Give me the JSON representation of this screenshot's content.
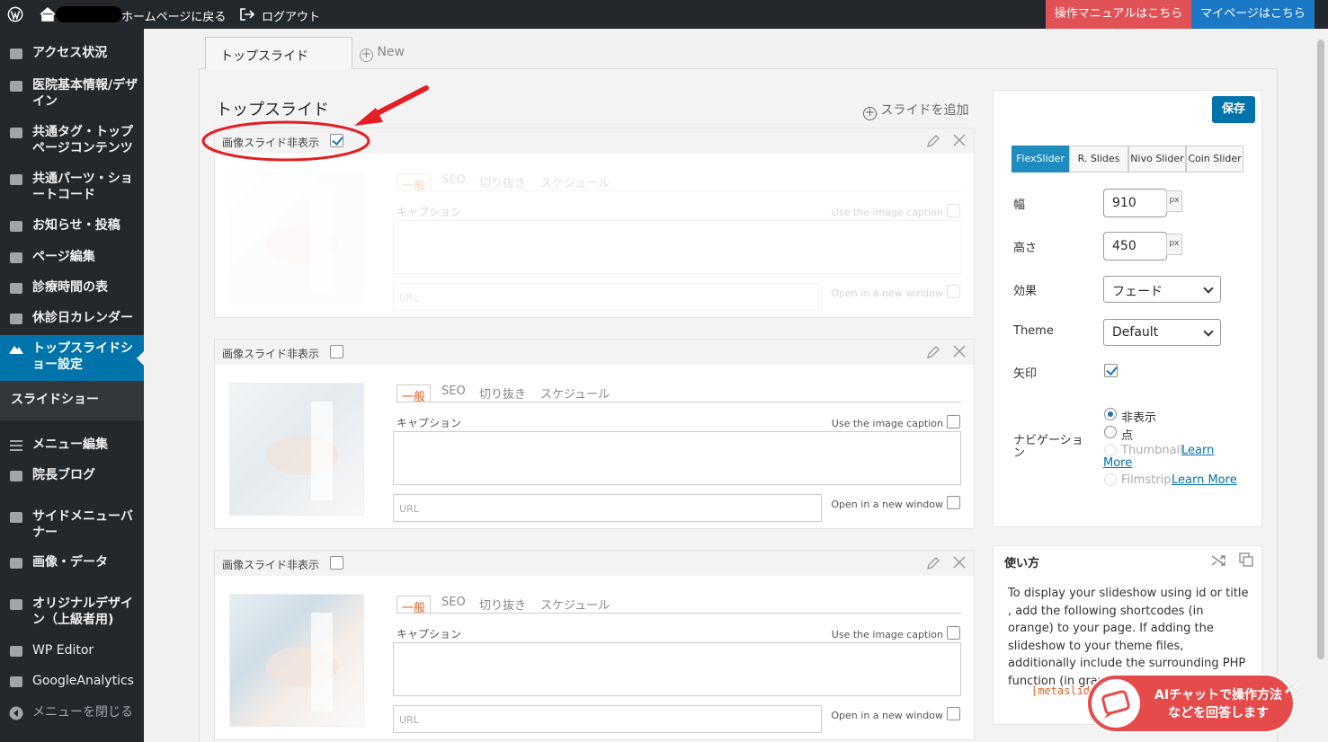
{
  "topbar": {
    "home_label": "ホームページに戻る",
    "logout_label": "ログアウト",
    "manual_button": "操作マニュアルはこちら",
    "mypage_button": "マイページはこちら"
  },
  "sidebar": {
    "items": [
      {
        "label": "アクセス状況",
        "icon": "chart-icon"
      },
      {
        "label": "医院基本情報/デザ\nイン",
        "icon": "eye-icon"
      },
      {
        "label": "共通タグ・トップ\nページコンテンツ",
        "icon": "layout-icon"
      },
      {
        "label": "共通パーツ・ショ\nートコード",
        "icon": "pin-icon"
      },
      {
        "label": "お知らせ・投稿",
        "icon": "flag-icon"
      },
      {
        "label": "ページ編集",
        "icon": "pages-icon"
      },
      {
        "label": "診療時間の表",
        "icon": "table-icon"
      },
      {
        "label": "休診日カレンダー",
        "icon": "calendar-icon"
      },
      {
        "label": "トップスライドシ\nョー設定",
        "icon": "mountain-icon"
      },
      {
        "label": "スライドショー",
        "icon": ""
      },
      {
        "label": "メニュー編集",
        "icon": "menu-icon"
      },
      {
        "label": "院長ブログ",
        "icon": "edit-icon"
      },
      {
        "label": "サイドメニューバ\nナー",
        "icon": "list-icon"
      },
      {
        "label": "画像・データ",
        "icon": "media-icon"
      },
      {
        "label": "オリジナルデザイ\nン（上級者用)",
        "icon": "wrench-icon"
      },
      {
        "label": "WP Editor",
        "icon": "pencil-icon"
      },
      {
        "label": "GoogleAnalytics",
        "icon": "analytics-icon"
      },
      {
        "label": "メニューを閉じる",
        "icon": "collapse-icon"
      }
    ]
  },
  "tabs": {
    "active": "トップスライド",
    "new": "New"
  },
  "section": {
    "title": "トップスライド",
    "add_slide": "スライドを追加"
  },
  "slide_card": {
    "hide_label": "画像スライド非表示",
    "tab_general": "一般",
    "tab_seo": "SEO",
    "tab_crop": "切り抜き",
    "tab_schedule": "スケジュール",
    "caption_label": "キャプション",
    "use_caption": "Use the image caption",
    "url_placeholder": "URL",
    "open_new_window": "Open in a new window"
  },
  "slides": [
    {
      "hidden": true
    },
    {
      "hidden": false
    },
    {
      "hidden": false
    }
  ],
  "settings": {
    "save": "保存",
    "slider_types": [
      "FlexSlider",
      "R. Slides",
      "Nivo Slider",
      "Coin Slider"
    ],
    "selected_type": "FlexSlider",
    "width_label": "幅",
    "width_value": "910",
    "height_label": "高さ",
    "height_value": "450",
    "unit": "px",
    "effect_label": "効果",
    "effect_value": "フェード",
    "theme_label": "Theme",
    "theme_value": "Default",
    "arrows_label": "矢印",
    "arrows_checked": true,
    "nav_label": "ナビゲーショ\nン",
    "nav_options": {
      "hidden": "非表示",
      "dots": "点",
      "thumbnail": "Thumbnail",
      "filmstrip": "Filmstrip",
      "learn_more": "Learn More",
      "learn": "Learn",
      "more": "More"
    }
  },
  "usage": {
    "title": "使い方",
    "text": "To display your slideshow using id or title , add the following shortcodes (in orange) to your page. If adding the slideshow to your theme files, additionally include the surrounding PHP function (in gray).",
    "code": "[metaslide"
  },
  "ai_chat": {
    "text": "AIチャットで操作方法\nなどを回答します"
  },
  "colors": {
    "accent": "#0073aa",
    "topbar": "#23282d",
    "manual": "#e05256",
    "mypage": "#1b78c6",
    "annotation": "#e31e24",
    "tab_orange": "#e25c1f"
  }
}
